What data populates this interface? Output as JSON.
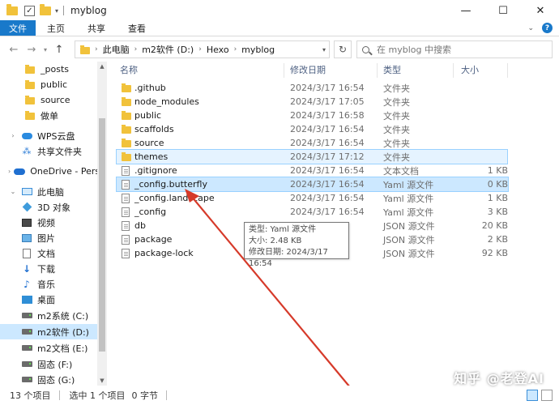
{
  "window": {
    "title": "myblog",
    "controls": [
      "—",
      "☐",
      "✕"
    ]
  },
  "ribbon": {
    "tabs": [
      "文件",
      "主页",
      "共享",
      "查看"
    ]
  },
  "address": {
    "crumbs": [
      "此电脑",
      "m2软件 (D:)",
      "Hexo",
      "myblog"
    ],
    "search_placeholder": "在 myblog 中搜索"
  },
  "nav": {
    "items": [
      {
        "label": "_posts",
        "icon": "folder-icon"
      },
      {
        "label": "public",
        "icon": "folder-icon"
      },
      {
        "label": "source",
        "icon": "folder-icon"
      },
      {
        "label": "做单",
        "icon": "folder-icon"
      },
      {
        "label": "WPS云盘",
        "icon": "wps-cloud-icon"
      },
      {
        "label": "共享文件夹",
        "icon": "share-icon"
      },
      {
        "label": "OneDrive - Perso",
        "icon": "onedrive-icon"
      },
      {
        "label": "此电脑",
        "icon": "computer-icon"
      },
      {
        "label": "3D 对象",
        "icon": "3d-objects-icon"
      },
      {
        "label": "视频",
        "icon": "video-icon"
      },
      {
        "label": "图片",
        "icon": "pictures-icon"
      },
      {
        "label": "文档",
        "icon": "documents-icon"
      },
      {
        "label": "下载",
        "icon": "download-icon"
      },
      {
        "label": "音乐",
        "icon": "music-icon"
      },
      {
        "label": "桌面",
        "icon": "desktop-icon"
      },
      {
        "label": "m2系统 (C:)",
        "icon": "drive-icon"
      },
      {
        "label": "m2软件 (D:)",
        "icon": "drive-icon"
      },
      {
        "label": "m2文档 (E:)",
        "icon": "drive-icon"
      },
      {
        "label": "固态 (F:)",
        "icon": "drive-icon"
      },
      {
        "label": "固态 (G:)",
        "icon": "drive-icon"
      }
    ]
  },
  "columns": {
    "name": "名称",
    "date": "修改日期",
    "type": "类型",
    "size": "大小"
  },
  "files": [
    {
      "name": ".github",
      "date": "2024/3/17 16:54",
      "type": "文件夹",
      "size": "",
      "kind": "folder"
    },
    {
      "name": "node_modules",
      "date": "2024/3/17 17:05",
      "type": "文件夹",
      "size": "",
      "kind": "folder"
    },
    {
      "name": "public",
      "date": "2024/3/17 16:58",
      "type": "文件夹",
      "size": "",
      "kind": "folder"
    },
    {
      "name": "scaffolds",
      "date": "2024/3/17 16:54",
      "type": "文件夹",
      "size": "",
      "kind": "folder"
    },
    {
      "name": "source",
      "date": "2024/3/17 16:54",
      "type": "文件夹",
      "size": "",
      "kind": "folder"
    },
    {
      "name": "themes",
      "date": "2024/3/17 17:12",
      "type": "文件夹",
      "size": "",
      "kind": "folder"
    },
    {
      "name": ".gitignore",
      "date": "2024/3/17 16:54",
      "type": "文本文档",
      "size": "1 KB",
      "kind": "file"
    },
    {
      "name": "_config.butterfly",
      "date": "2024/3/17 16:54",
      "type": "Yaml 源文件",
      "size": "0 KB",
      "kind": "file"
    },
    {
      "name": "_config.landscape",
      "date": "2024/3/17 16:54",
      "type": "Yaml 源文件",
      "size": "1 KB",
      "kind": "file"
    },
    {
      "name": "_config",
      "date": "2024/3/17 16:54",
      "type": "Yaml 源文件",
      "size": "3 KB",
      "kind": "file"
    },
    {
      "name": "db",
      "date": "",
      "type": "JSON 源文件",
      "size": "20 KB",
      "kind": "file"
    },
    {
      "name": "package",
      "date": "",
      "type": "JSON 源文件",
      "size": "2 KB",
      "kind": "file"
    },
    {
      "name": "package-lock",
      "date": "",
      "type": "JSON 源文件",
      "size": "92 KB",
      "kind": "file"
    }
  ],
  "tooltip": {
    "line1": "类型: Yaml 源文件",
    "line2": "大小: 2.48 KB",
    "line3": "修改日期: 2024/3/17 16:54"
  },
  "status": {
    "count": "13 个项目",
    "selected": "选中 1 个项目",
    "size": "0 字节"
  },
  "watermark": "知乎 @老登AI",
  "colors": {
    "accent": "#1979ca",
    "selection": "#cce8ff",
    "folder": "#f1c23b",
    "arrow": "#d63a2a"
  }
}
